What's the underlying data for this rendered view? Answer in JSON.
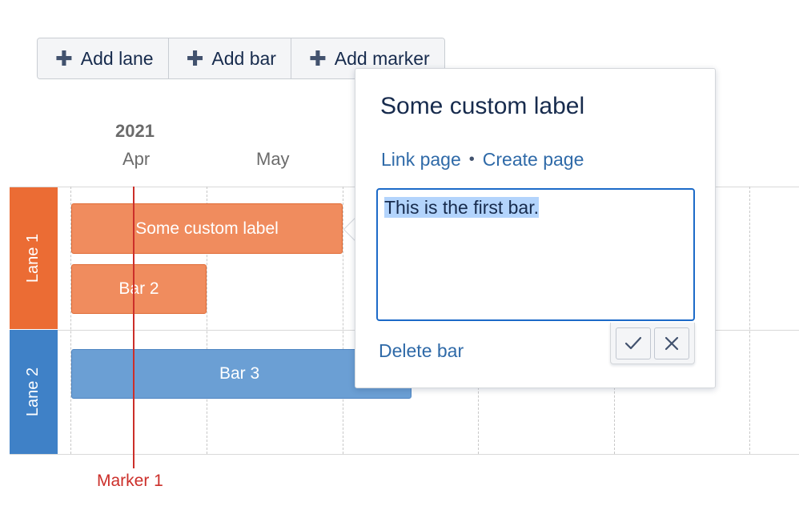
{
  "toolbar": {
    "add_lane": "Add lane",
    "add_bar": "Add bar",
    "add_marker": "Add marker",
    "icon": "plus-icon"
  },
  "timeline": {
    "year": "2021",
    "months": [
      "Apr",
      "May"
    ]
  },
  "lanes": [
    {
      "label": "Lane 1",
      "color": "#eb6c34"
    },
    {
      "label": "Lane 2",
      "color": "#3f81c7"
    }
  ],
  "bars": [
    {
      "label": "Some custom label",
      "lane": "Lane 1",
      "color": "#f08c5e"
    },
    {
      "label": "Bar 2",
      "lane": "Lane 1",
      "color": "#f08c5e"
    },
    {
      "label": "Bar 3",
      "lane": "Lane 2",
      "color": "#6b9fd4"
    }
  ],
  "marker": {
    "label": "Marker 1",
    "color": "#cc2f2a"
  },
  "popup": {
    "title": "Some custom label",
    "link_page": "Link page",
    "separator": "•",
    "create_page": "Create page",
    "description": "This is the first bar.",
    "delete_bar": "Delete bar",
    "confirm_icon": "checkmark-icon",
    "cancel_icon": "close-icon"
  },
  "colors": {
    "link": "#2f6aa8",
    "focus_border": "#1c6ac8",
    "selection": "#b3d4fc"
  }
}
